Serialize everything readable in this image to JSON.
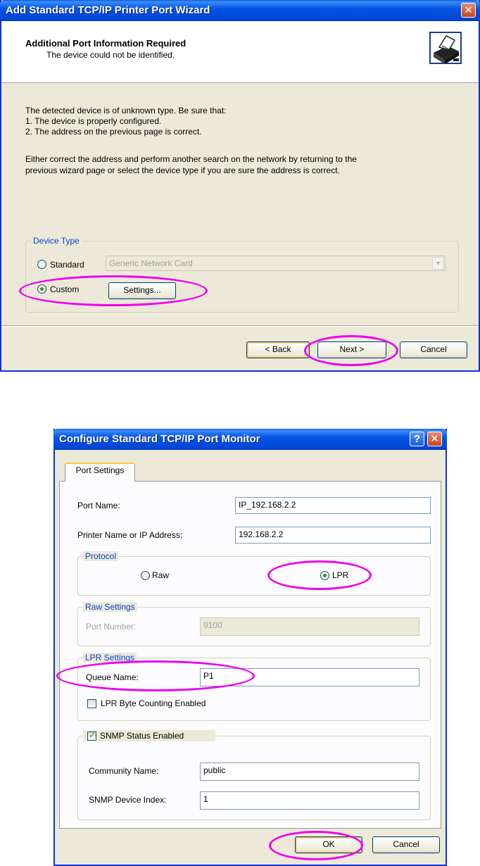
{
  "wizard": {
    "title": "Add Standard TCP/IP Printer Port Wizard",
    "header_title": "Additional Port Information Required",
    "header_subtitle": "The device could not be identified.",
    "body_line1": "The detected device is of unknown type.  Be sure that:",
    "body_line2": "1. The device is properly configured.",
    "body_line3": "2.  The address on the previous page is correct.",
    "body_para2_line1": "Either correct the address and perform another search on the network by returning to the",
    "body_para2_line2": "previous wizard page or select the device type if you are sure the address is correct.",
    "device_type_label": "Device Type",
    "standard_label": "Standard",
    "custom_label": "Custom",
    "combo_value": "Generic Network Card",
    "settings_button": "Settings...",
    "back_button": "< Back",
    "next_button": "Next >",
    "cancel_button": "Cancel"
  },
  "monitor": {
    "title": "Configure Standard TCP/IP Port Monitor",
    "tab_label": "Port Settings",
    "port_name_label": "Port Name:",
    "port_name_value": "IP_192.168.2.2",
    "printer_name_label": "Printer Name or IP Address:",
    "printer_name_value": "192.168.2.2",
    "protocol_label": "Protocol",
    "raw_label": "Raw",
    "lpr_label": "LPR",
    "raw_settings_label": "Raw Settings",
    "port_number_label": "Port Number:",
    "port_number_value": "9100",
    "lpr_settings_label": "LPR Settings",
    "queue_name_label": "Queue Name:",
    "queue_name_value": "P1",
    "lpr_byte_label": "LPR Byte Counting Enabled",
    "snmp_label": "SNMP Status Enabled",
    "community_label": "Community Name:",
    "community_value": "public",
    "snmp_index_label": "SNMP Device Index:",
    "snmp_index_value": "1",
    "ok_button": "OK",
    "cancel_button": "Cancel"
  },
  "state": {
    "standard_selected": false,
    "custom_selected": true,
    "raw_selected": false,
    "lpr_selected": true,
    "lpr_byte_counting": false,
    "snmp_enabled": true
  },
  "colors": {
    "titlebar": "#0054e3",
    "window_face": "#ece9d8",
    "highlight_ellipse": "#ee00ee",
    "group_label": "#0046d5",
    "radio_dot": "#21a121"
  },
  "icons": {
    "wizard_header": "printer-icon",
    "close": "close-icon",
    "help": "help-icon"
  }
}
